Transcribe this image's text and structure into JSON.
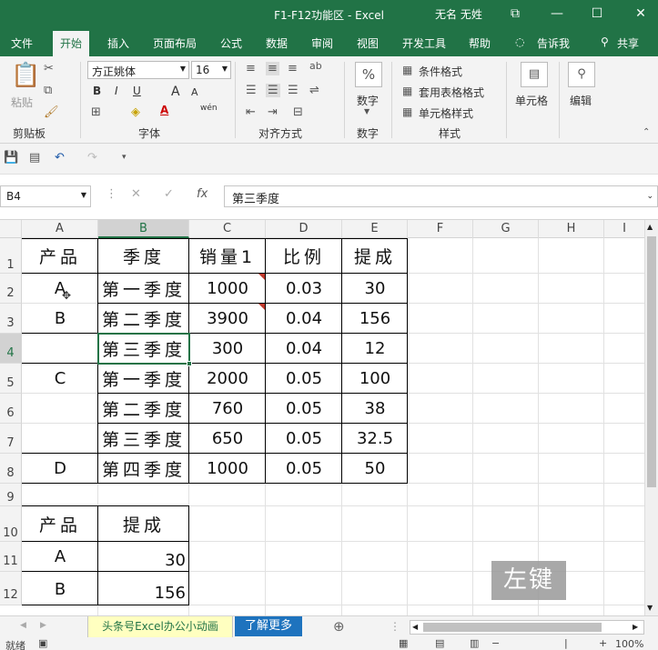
{
  "window": {
    "title": "F1-F12功能区",
    "app": "Excel",
    "user": "无名 无姓",
    "controls": [
      "⧉",
      "—",
      "☐",
      "✕"
    ]
  },
  "ribbon_tabs": [
    "文件",
    "开始",
    "插入",
    "页面布局",
    "公式",
    "数据",
    "审阅",
    "视图",
    "开发工具",
    "帮助",
    "告诉我",
    "共享"
  ],
  "active_tab": "开始",
  "ribbon": {
    "clipboard": {
      "paste": "粘贴",
      "label": "剪贴板"
    },
    "font": {
      "name": "方正姚体",
      "size": "16",
      "label": "字体",
      "bold": "B",
      "italic": "I",
      "underline": "U",
      "grow": "A",
      "shrink": "A",
      "wen": "wén"
    },
    "alignment": {
      "label": "对齐方式"
    },
    "number": {
      "label": "数字",
      "percent": "%"
    },
    "styles": {
      "cond": "条件格式",
      "table": "套用表格格式",
      "cell": "单元格样式",
      "label": "样式"
    },
    "cells": {
      "label": "单元格"
    },
    "editing": {
      "label": "编辑"
    }
  },
  "formula_bar": {
    "name_box": "B4",
    "fx": "fx",
    "value": "第三季度"
  },
  "columns": [
    "A",
    "B",
    "C",
    "D",
    "E",
    "F",
    "G",
    "H",
    "I"
  ],
  "selected_column": "B",
  "rows": [
    "1",
    "2",
    "3",
    "4",
    "5",
    "6",
    "7",
    "8",
    "9",
    "10",
    "11",
    "12"
  ],
  "selected_row": "4",
  "table1": {
    "header": [
      "产品",
      "季度",
      "销量1",
      "比例",
      "提成"
    ],
    "rows": [
      [
        "A",
        "第一季度",
        "1000",
        "0.03",
        "30"
      ],
      [
        "B",
        "第二季度",
        "3900",
        "0.04",
        "156"
      ],
      [
        "",
        "第三季度",
        "300",
        "0.04",
        "12"
      ],
      [
        "C",
        "第一季度",
        "2000",
        "0.05",
        "100"
      ],
      [
        "",
        "第二季度",
        "760",
        "0.05",
        "38"
      ],
      [
        "",
        "第三季度",
        "650",
        "0.05",
        "32.5"
      ],
      [
        "D",
        "第四季度",
        "1000",
        "0.05",
        "50"
      ]
    ]
  },
  "table2": {
    "header": [
      "产品",
      "提成"
    ],
    "rows": [
      [
        "A",
        "30"
      ],
      [
        "B",
        "156"
      ]
    ]
  },
  "sheet_tabs": [
    "头条号Excel办公小动画",
    "了解更多"
  ],
  "status": {
    "ready": "就绪",
    "zoom": "100%"
  },
  "watermark": "左键",
  "colors": {
    "excel_green": "#217346",
    "sheet_tab_active": "#ffffc0",
    "tab_more": "#1e73be"
  }
}
